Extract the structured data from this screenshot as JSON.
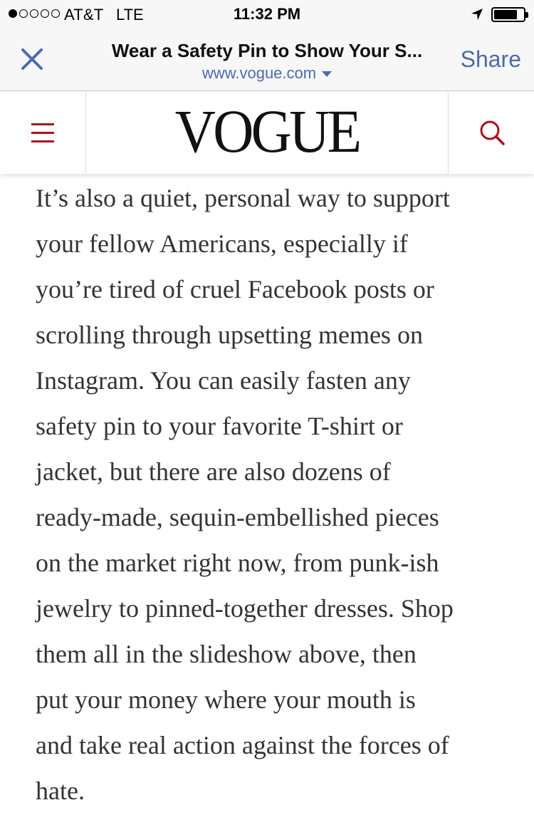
{
  "status_bar": {
    "carrier": "AT&T",
    "network": "LTE",
    "time": "11:32 PM",
    "signal_bars_filled": 1,
    "signal_bars_total": 5,
    "battery_level": 0.8
  },
  "browser": {
    "page_title": "Wear a Safety Pin to Show Your S...",
    "url": "www.vogue.com",
    "share_label": "Share",
    "close_icon": "close-icon",
    "accent_color": "#4a6ab4"
  },
  "site_header": {
    "logo_text": "VOGUE",
    "menu_icon": "hamburger-icon",
    "search_icon": "search-icon",
    "brand_color": "#b00f1c"
  },
  "article": {
    "lines": [
      "It’s also a quiet, personal way to support",
      "your fellow Americans, especially if",
      "you’re tired of cruel Facebook posts or",
      "scrolling through upsetting memes on",
      "Instagram. You can easily fasten any",
      "safety pin to your favorite T-shirt or",
      "jacket, but there are also dozens of",
      "ready-made, sequin-embellished pieces",
      "on the market right now, from punk-ish",
      "jewelry to pinned-together dresses. Shop",
      "them all in the slideshow above, then",
      "put your money where your mouth is",
      "and take real action against the forces of",
      "hate."
    ]
  }
}
